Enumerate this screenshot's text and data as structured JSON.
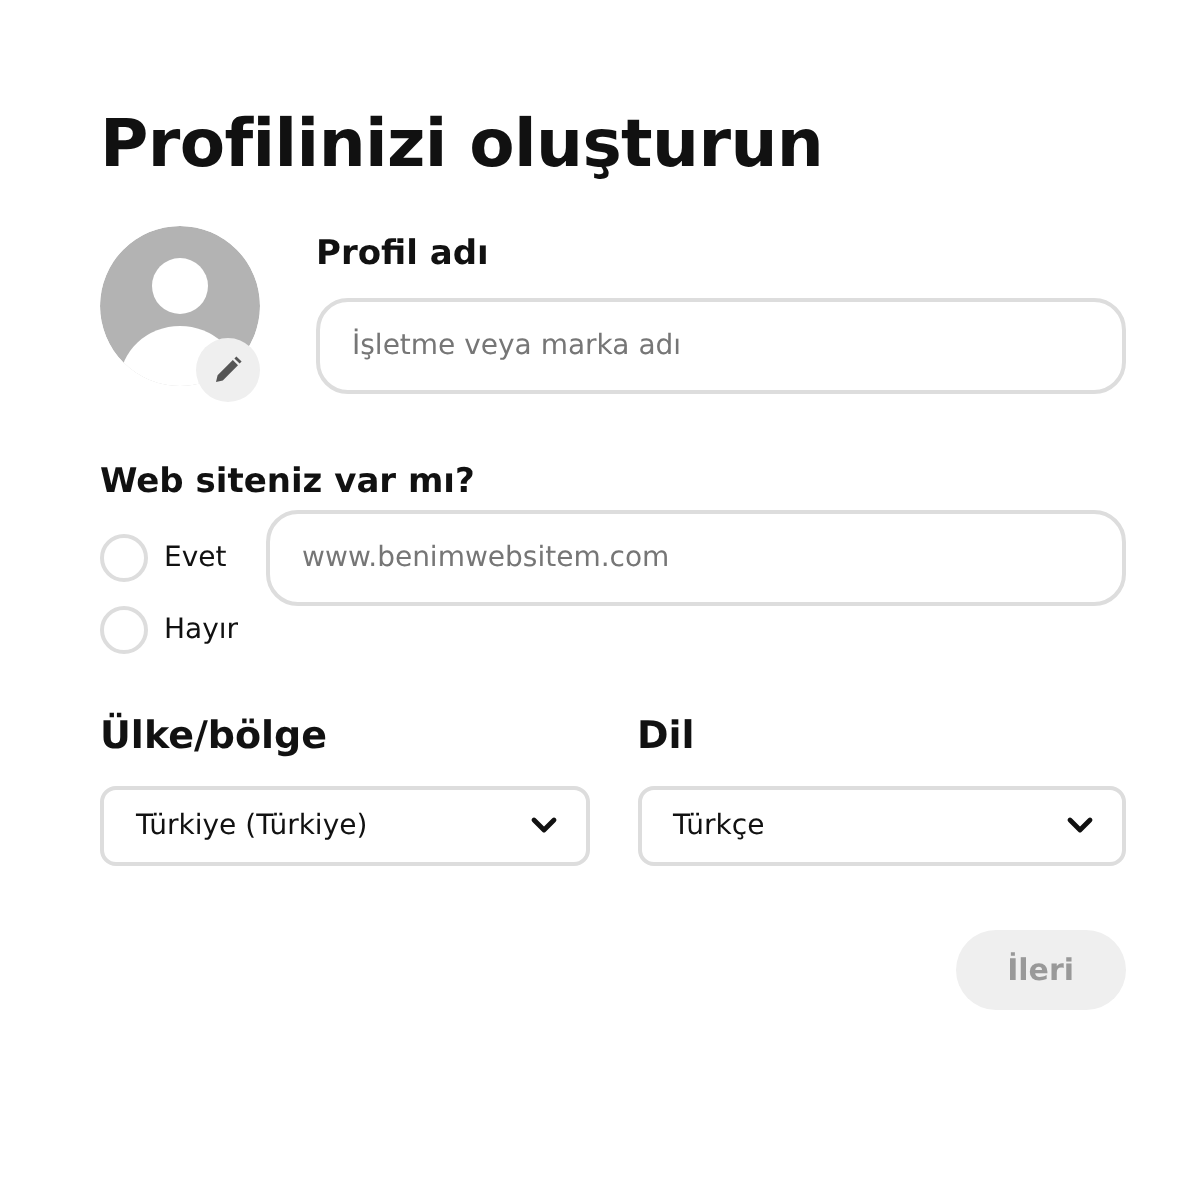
{
  "title": "Profilinizi oluşturun",
  "profile": {
    "label": "Profil adı",
    "placeholder": "İşletme veya marka adı"
  },
  "website": {
    "question": "Web siteniz var mı?",
    "placeholder": "www.benimwebsitem.com",
    "options": [
      {
        "label": "Evet",
        "selected": false
      },
      {
        "label": "Hayır",
        "selected": false
      }
    ]
  },
  "selects": [
    {
      "label": "Ülke/bölge",
      "value": "Türkiye (Türkiye)"
    },
    {
      "label": "Dil",
      "value": "Türkçe"
    }
  ],
  "next_button": {
    "label": "İleri",
    "disabled": true
  }
}
